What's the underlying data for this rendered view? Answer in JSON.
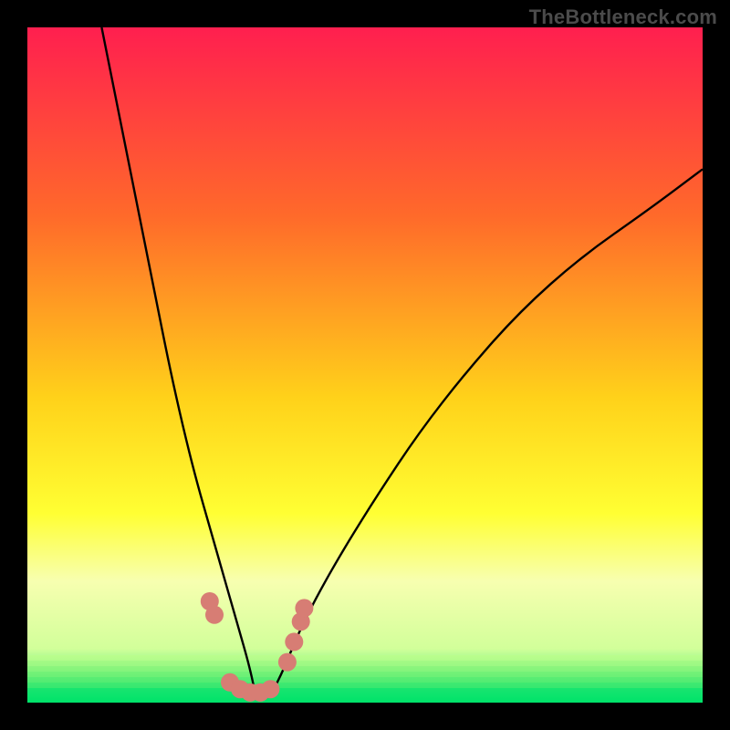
{
  "watermark": "TheBottleneck.com",
  "colors": {
    "frame": "#000000",
    "grad_top": "#ff1f4f",
    "grad_mid1": "#ff6a2a",
    "grad_mid2": "#ffd21a",
    "grad_mid3": "#ffff33",
    "grad_mid4": "#f7ffb0",
    "grad_bottom_band_top": "#d2ff9a",
    "grad_bottom_green": "#00e56a",
    "curve": "#000000",
    "marker_fill": "#d77d74",
    "marker_stroke": "#d77d74"
  },
  "chart_data": {
    "type": "line",
    "title": "",
    "xlabel": "",
    "ylabel": "",
    "xlim": [
      0,
      100
    ],
    "ylim": [
      0,
      100
    ],
    "note": "No axis ticks or numeric labels are shown in the image. x/y values below are read off as normalized 0–100 positions within the plot area; minimum of the curve sits near x≈34, y≈0.",
    "series": [
      {
        "name": "bottleneck-curve",
        "x": [
          11,
          13,
          15,
          17,
          19,
          21,
          23,
          25,
          27,
          29,
          31,
          33,
          34,
          36,
          38,
          40,
          43,
          47,
          52,
          58,
          65,
          73,
          82,
          92,
          100
        ],
        "y": [
          100,
          90,
          80,
          70,
          60,
          50,
          41,
          33,
          26,
          19,
          12,
          5,
          0,
          1,
          5,
          10,
          16,
          23,
          31,
          40,
          49,
          58,
          66,
          73,
          79
        ]
      }
    ],
    "markers": {
      "name": "highlighted-points",
      "comment": "Pink rounded markers near the basin of the curve.",
      "points": [
        [
          27,
          15
        ],
        [
          27.7,
          13
        ],
        [
          30,
          3
        ],
        [
          31.5,
          2
        ],
        [
          33,
          1.5
        ],
        [
          34.5,
          1.5
        ],
        [
          36,
          2
        ],
        [
          38.5,
          6
        ],
        [
          39.5,
          9
        ],
        [
          40.5,
          12
        ],
        [
          41,
          14
        ]
      ]
    }
  }
}
